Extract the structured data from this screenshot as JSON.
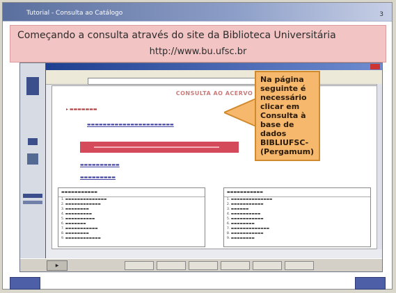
{
  "slide": {
    "top_title": "Tutorial - Consulta ao Catálogo",
    "page_number": "3",
    "heading_line1": "Começando a consulta através do site da Biblioteca Universitária",
    "heading_line2": "http://www.bu.ufsc.br"
  },
  "callout": {
    "text": "Na página seguinte é necessário clicar em Consulta à base de dados BIBLIUFSC- (Pergamum)"
  },
  "browser": {
    "page_title": "CONSULTA AO ACERVO"
  },
  "nav": {
    "prev_icon": "nav-left-icon",
    "next_icon": "nav-right-icon"
  },
  "colors": {
    "heading_band": "#f2c4c4",
    "callout": "#f6b86c",
    "nav_button": "#4d5fa6",
    "red_bar": "#d44a5a"
  }
}
